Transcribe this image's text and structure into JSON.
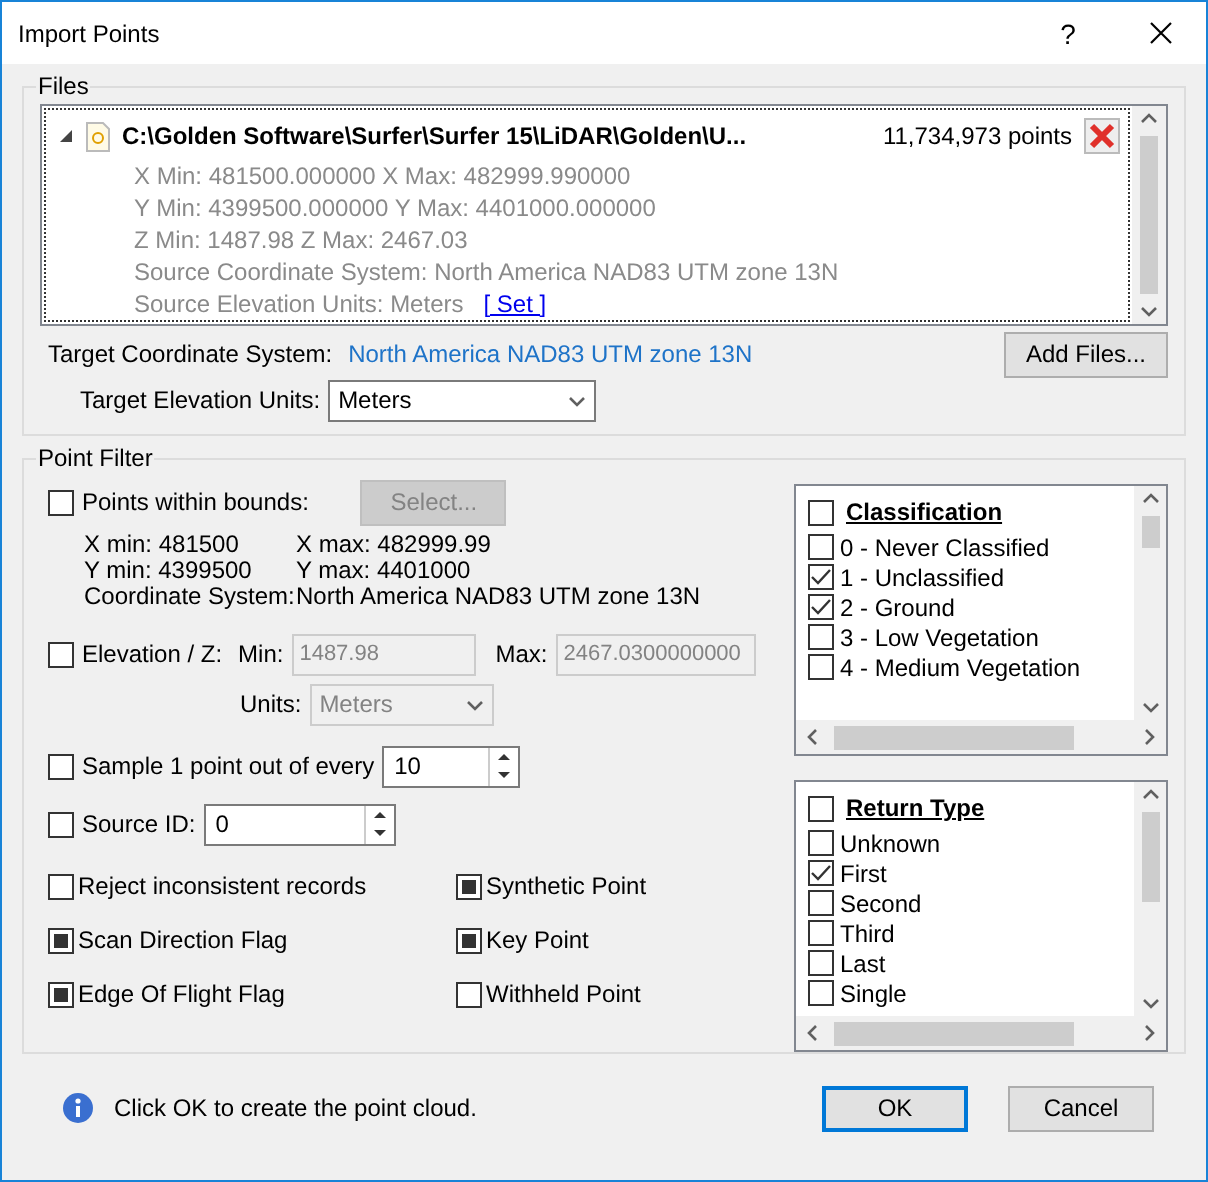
{
  "window": {
    "title": "Import Points",
    "help_button": "?"
  },
  "files": {
    "legend": "Files",
    "file": {
      "path": "C:\\Golden Software\\Surfer\\Surfer 15\\LiDAR\\Golden\\U...",
      "points": "11,734,973 points",
      "expanded": true,
      "details": [
        "X Min: 481500.000000 X Max: 482999.990000",
        "Y Min: 4399500.000000 Y Max: 4401000.000000",
        "Z Min: 1487.98 Z Max: 2467.03",
        "Source Coordinate System: North America NAD83 UTM zone 13N"
      ],
      "units_line": "Source Elevation Units: Meters",
      "set_link": "[ Set ]"
    },
    "target_cs_label": "Target Coordinate System:",
    "target_cs_value": "North America NAD83 UTM zone 13N",
    "add_files_button": "Add Files...",
    "target_units_label": "Target Elevation Units:",
    "target_units_value": "Meters"
  },
  "point_filter": {
    "legend": "Point Filter",
    "bounds": {
      "label": "Points within bounds:",
      "checked": false,
      "mixed": false,
      "select_button": "Select...",
      "x_min": "X min: 481500",
      "x_max": "X max: 482999.99",
      "y_min": "Y min: 4399500",
      "y_max": "Y max: 4401000",
      "cs_label": "Coordinate System:",
      "cs_value": "North America NAD83 UTM zone 13N"
    },
    "elevation": {
      "label": "Elevation / Z:",
      "checked": false,
      "mixed": false,
      "min_label": "Min:",
      "min_value": "1487.98",
      "max_label": "Max:",
      "max_value": "2467.0300000000",
      "units_label": "Units:",
      "units_value": "Meters"
    },
    "sample": {
      "label": "Sample 1 point out of every",
      "checked": false,
      "mixed": false,
      "value": "10"
    },
    "source_id": {
      "label": "Source ID:",
      "checked": false,
      "mixed": false,
      "value": "0"
    },
    "flags": [
      {
        "label": "Reject inconsistent records",
        "checked": false,
        "mixed": false
      },
      {
        "label": "Synthetic Point",
        "checked": false,
        "mixed": true
      },
      {
        "label": "Scan Direction Flag",
        "checked": false,
        "mixed": true
      },
      {
        "label": "Key Point",
        "checked": false,
        "mixed": true
      },
      {
        "label": "Edge Of Flight Flag",
        "checked": false,
        "mixed": true
      },
      {
        "label": "Withheld Point",
        "checked": false,
        "mixed": false
      }
    ],
    "lists": [
      {
        "title": "Classification",
        "checked": false,
        "items": [
          {
            "label": "0 - Never Classified",
            "checked": false
          },
          {
            "label": "1 - Unclassified",
            "checked": true
          },
          {
            "label": "2 - Ground",
            "checked": true
          },
          {
            "label": "3 - Low Vegetation",
            "checked": false
          },
          {
            "label": "4 - Medium Vegetation",
            "checked": false
          }
        ]
      },
      {
        "title": "Return Type",
        "checked": false,
        "items": [
          {
            "label": "Unknown",
            "checked": false
          },
          {
            "label": "First",
            "checked": true
          },
          {
            "label": "Second",
            "checked": false
          },
          {
            "label": "Third",
            "checked": false
          },
          {
            "label": "Last",
            "checked": false
          },
          {
            "label": "Single",
            "checked": false
          }
        ]
      }
    ]
  },
  "footer": {
    "message": "Click OK to create the point cloud.",
    "ok_button": "OK",
    "cancel_button": "Cancel"
  }
}
